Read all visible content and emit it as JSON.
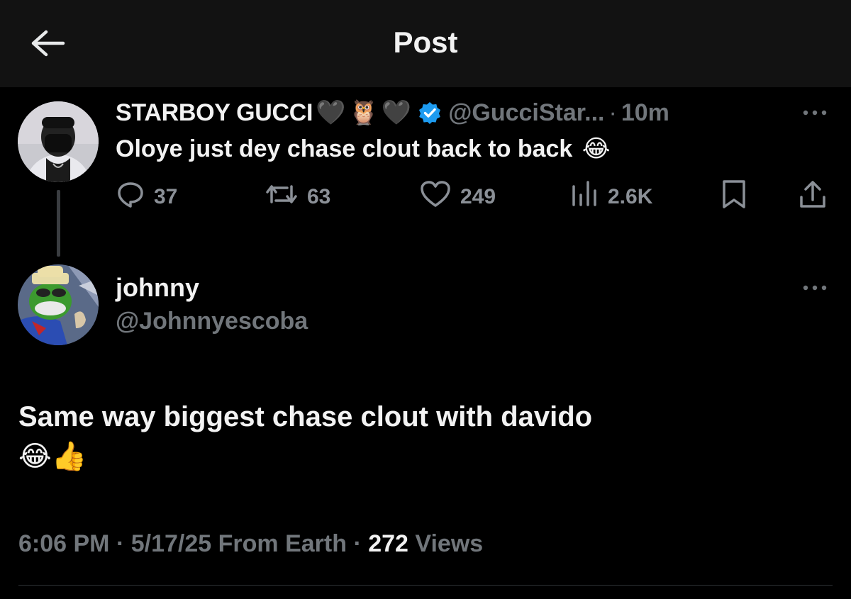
{
  "header": {
    "title": "Post",
    "back_icon": "arrow-left-icon"
  },
  "parent_post": {
    "display_name": "STARBOY GUCCI",
    "name_emojis": [
      "🖤",
      "🦉",
      "🖤"
    ],
    "verified": true,
    "handle": "@GucciStar...",
    "separator": "·",
    "time": "10m",
    "text": "Oloye just dey chase clout back to back",
    "text_emoji": "😂",
    "actions": {
      "replies": "37",
      "reposts": "63",
      "likes": "249",
      "views": "2.6K"
    }
  },
  "reply": {
    "display_name": "johnny",
    "handle": "@Johnnyescoba",
    "text": "Same way biggest chase clout with davido",
    "emojis": "😂👍"
  },
  "meta": {
    "time": "6:06 PM",
    "date": "5/17/25",
    "location": "From Earth",
    "sep": "·",
    "views_count": "272",
    "views_label": "Views"
  },
  "colors": {
    "background": "#000000",
    "header": "#121212",
    "muted": "#71767b",
    "verified": "#1d9bf0"
  }
}
